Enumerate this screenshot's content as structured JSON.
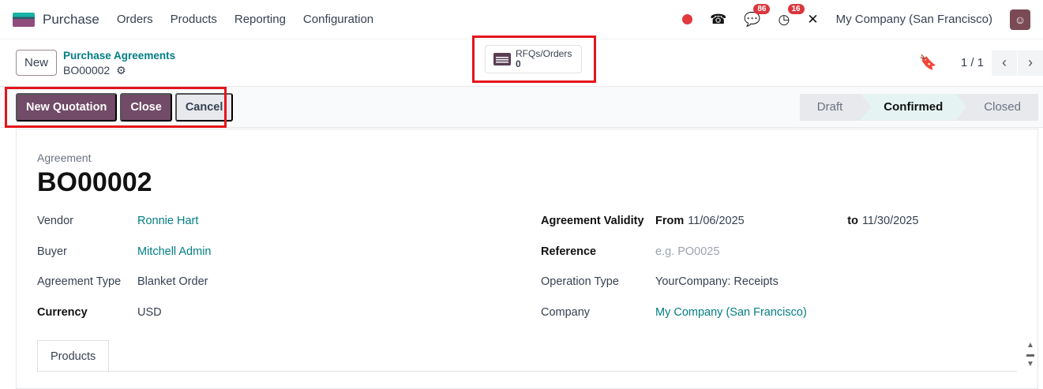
{
  "nav": {
    "app": "Purchase",
    "menus": [
      "Orders",
      "Products",
      "Reporting",
      "Configuration"
    ],
    "messages_count": "86",
    "activities_count": "16",
    "company": "My Company (San Francisco)"
  },
  "control": {
    "new_label": "New",
    "breadcrumb_parent": "Purchase Agreements",
    "breadcrumb_current": "BO00002",
    "rfq_label": "RFQs/Orders",
    "rfq_count": "0",
    "pager": "1 / 1"
  },
  "actions": {
    "new_quotation": "New Quotation",
    "close": "Close",
    "cancel": "Cancel"
  },
  "status": {
    "stages": [
      "Draft",
      "Confirmed",
      "Closed"
    ],
    "current": "Confirmed"
  },
  "form": {
    "caption": "Agreement",
    "name": "BO00002",
    "left": [
      {
        "label": "Vendor",
        "value": "Ronnie Hart"
      },
      {
        "label": "Buyer",
        "value": "Mitchell Admin"
      },
      {
        "label": "Agreement Type",
        "value": "Blanket Order"
      },
      {
        "label": "Currency",
        "value": "USD"
      }
    ],
    "validity_label": "Agreement Validity",
    "from_label": "From",
    "from": "11/06/2025",
    "to_label": "to",
    "to": "11/30/2025",
    "reference_label": "Reference",
    "reference_placeholder": "e.g. PO0025",
    "operation_label": "Operation Type",
    "operation": "YourCompany: Receipts",
    "company_label": "Company",
    "company": "My Company (San Francisco)"
  },
  "tabs": [
    "Products"
  ],
  "colors": {
    "primary": "#714b67",
    "link": "#017e84",
    "highlight": "#e4141c"
  }
}
